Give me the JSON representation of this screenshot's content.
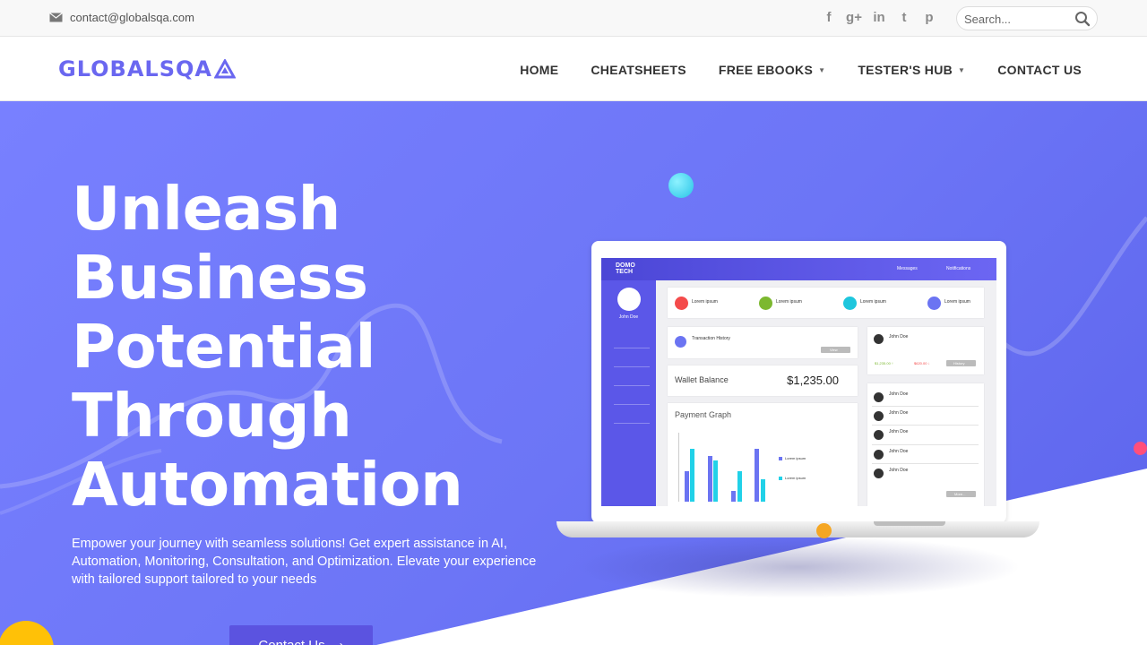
{
  "topbar": {
    "email": "contact@globalsqa.com",
    "socials": [
      {
        "icon": "facebook-icon",
        "glyph": "f"
      },
      {
        "icon": "google-plus-icon",
        "glyph": "g+"
      },
      {
        "icon": "linkedin-icon",
        "glyph": "in"
      },
      {
        "icon": "twitter-icon",
        "glyph": "t"
      },
      {
        "icon": "pinterest-icon",
        "glyph": "p"
      }
    ],
    "search": {
      "placeholder": "Search...",
      "value": ""
    }
  },
  "header": {
    "logo": "GLOBALSQA",
    "nav": [
      {
        "label": "HOME",
        "dropdown": false
      },
      {
        "label": "CHEATSHEETS",
        "dropdown": false
      },
      {
        "label": "FREE EBOOKS",
        "dropdown": true
      },
      {
        "label": "TESTER'S HUB",
        "dropdown": true
      },
      {
        "label": "CONTACT US",
        "dropdown": false
      }
    ]
  },
  "hero": {
    "headline": [
      "Unleash",
      "Business",
      "Potential",
      "Through",
      "Automation"
    ],
    "lead": "Empower your journey with seamless solutions! Get expert assistance in AI, Automation, Monitoring, Consultation, and Optimization. Elevate your experience with tailored support tailored to your needs",
    "cta": "Contact Us",
    "cta_arrow": "›"
  },
  "laptop": {
    "brand_line1": "DOMO",
    "brand_line2": "TECH",
    "messages": "Messages",
    "notifications": "Notifications",
    "user": "John Doe",
    "stat_label": "Lorem ipsum",
    "transaction_title": "Transaction History",
    "view": "View",
    "wallet_label": "Wallet Balance",
    "wallet_value": "$1,235.00",
    "graph_title": "Payment Graph",
    "contact_name": "John Doe",
    "history": "History",
    "more": "More..."
  },
  "colors": {
    "brand": "#6a67f0",
    "hero": "#6c75f6",
    "cta": "#5b53e0"
  }
}
